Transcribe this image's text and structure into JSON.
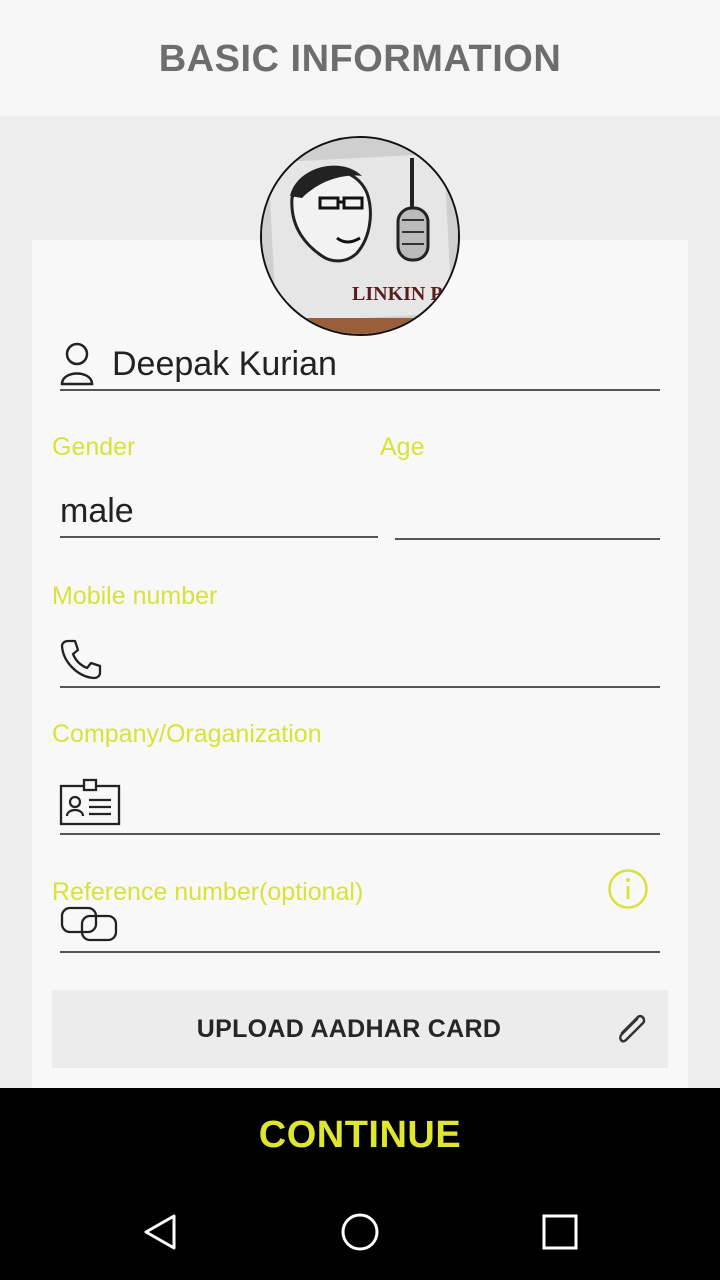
{
  "header": {
    "title": "BASIC INFORMATION"
  },
  "profile": {
    "avatar_icon": "profile-photo",
    "avatar_caption": "LINKIN PARK",
    "name_value": "Deepak Kurian"
  },
  "form": {
    "gender_label": "Gender",
    "gender_value": "male",
    "age_label": "Age",
    "age_value": "",
    "mobile_label": "Mobile number",
    "mobile_value": "",
    "company_label": "Company/Oraganization",
    "company_value": "",
    "reference_label": "Reference number(optional)",
    "reference_value": ""
  },
  "upload": {
    "label": "UPLOAD AADHAR CARD",
    "icon": "paperclip-icon"
  },
  "cta": {
    "continue_label": "CONTINUE"
  },
  "colors": {
    "accent": "#dfe62f",
    "label": "#d9e23a",
    "background": "#ededed"
  },
  "navbar": {
    "icons": [
      "back-icon",
      "home-icon",
      "recents-icon"
    ]
  }
}
